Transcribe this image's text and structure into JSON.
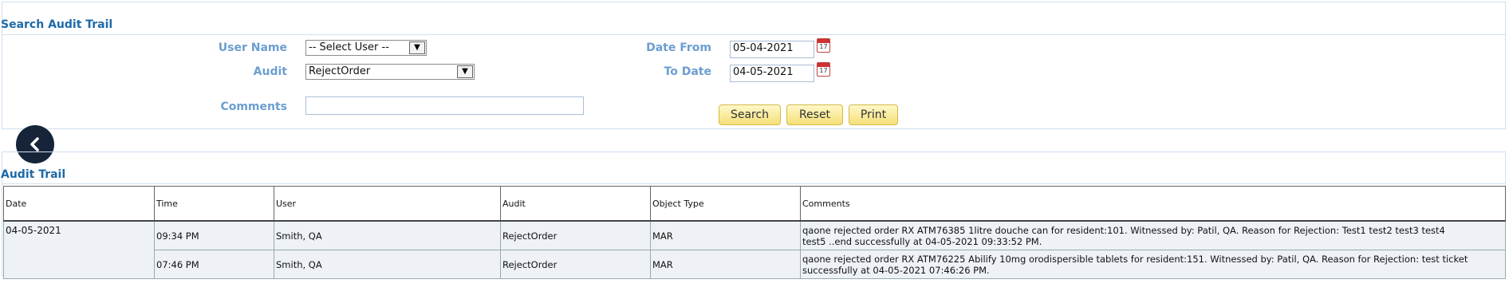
{
  "search": {
    "title": "Search Audit Trail",
    "user_name_label": "User Name",
    "user_name_value": "-- Select User --",
    "audit_label": "Audit",
    "audit_value": "RejectOrder",
    "comments_label": "Comments",
    "comments_value": "",
    "date_from_label": "Date From",
    "date_from_value": "05-04-2021",
    "to_date_label": "To Date",
    "to_date_value": "04-05-2021",
    "calendar_number": "17",
    "buttons": {
      "search": "Search",
      "reset": "Reset",
      "print": "Print"
    }
  },
  "audit_trail": {
    "title": "Audit Trail",
    "columns": [
      "Date",
      "Time",
      "User",
      "Audit",
      "Object Type",
      "Comments"
    ],
    "date_group": "04-05-2021",
    "rows": [
      {
        "time": "09:34 PM",
        "user": "Smith, QA",
        "audit": "RejectOrder",
        "object_type": "MAR",
        "comments_line1": "qaone rejected order RX ATM76385 1litre douche can for resident:101. Witnessed by: Patil, QA. Reason for Rejection: Test1 test2 test3 test4",
        "comments_line2": "test5 ..end successfully at 04-05-2021 09:33:52 PM."
      },
      {
        "time": "07:46 PM",
        "user": "Smith, QA",
        "audit": "RejectOrder",
        "object_type": "MAR",
        "comments_line1": "qaone rejected order RX ATM76225 Abilify 10mg orodispersible tablets for resident:151. Witnessed by: Patil, QA. Reason for Rejection: test ticket",
        "comments_line2": "successfully at 04-05-2021 07:46:26 PM."
      }
    ]
  },
  "icons": {
    "back": "chevron-left-icon",
    "calendar": "calendar-icon"
  },
  "colors": {
    "label": "#6b9ed0",
    "title": "#1d6aa8",
    "button": "#f5df78",
    "back": "#16243a"
  }
}
